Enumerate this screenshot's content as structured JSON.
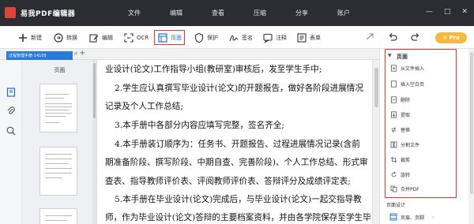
{
  "app": {
    "title": "易我PDF编辑器"
  },
  "menu": [
    "文件",
    "编辑",
    "查看",
    "压缩",
    "分享",
    "账户"
  ],
  "toolbar": {
    "new_label": "新建",
    "convert_label": "转换",
    "edit_label": "编辑",
    "ocr_label": "OCR",
    "page_label": "页面",
    "protect_label": "保护",
    "sign_label": "签名",
    "comment_label": "注释",
    "form_label": "表单",
    "pro_label": "Pro"
  },
  "tab": {
    "label": "过程管理手册-14105",
    "active_color": "#2a7ad8"
  },
  "sidebar": {
    "pages_label": "页面"
  },
  "document": {
    "lines": [
      "业设计(论文)工作指导小组(教研室)审核后，发至学生手中;",
      "2.学生应认真撰写毕业设计(论文)的开题报告，做好各阶段进展情况",
      "记录及个人工作总结;",
      "3.本手册中各部分内容应填写完整，签名齐全;",
      "4.本手册装订顺序为：任务书、开题报告、过程进展情况记录(含前",
      "期准备阶段、撰写阶段、中期自查、完善阶段)、个人工作总结、形式审",
      "查表、指导教师评价表、评阅教师评价表、答辩评分及成绩评定表;",
      "5.本手册在毕业设计(论文)完成后，与毕业设计(论文)一起交指导教",
      "师，作为毕业设计(论文)答辩的主要档案资料，并由各学院保存至学生毕"
    ]
  },
  "right_panel": {
    "header": "页面",
    "items": [
      {
        "label": "从文件插入",
        "icon": "file-insert-icon"
      },
      {
        "label": "插入空白页",
        "icon": "blank-page-icon"
      },
      {
        "label": "删除",
        "icon": "delete-icon"
      },
      {
        "label": "提取",
        "icon": "extract-icon"
      },
      {
        "label": "替换",
        "icon": "replace-icon"
      },
      {
        "label": "分割文件",
        "icon": "split-icon"
      },
      {
        "label": "裁剪",
        "icon": "crop-icon"
      },
      {
        "label": "旋转",
        "icon": "rotate-icon"
      },
      {
        "label": "合并PDF",
        "icon": "merge-icon"
      }
    ],
    "design_section": "页面设计",
    "design_item": "页眉、页脚"
  },
  "colors": {
    "highlight": "#e33333",
    "accent": "#1d6fd8",
    "titlebar": "#2b2d33",
    "pro": "#f6b93b"
  }
}
